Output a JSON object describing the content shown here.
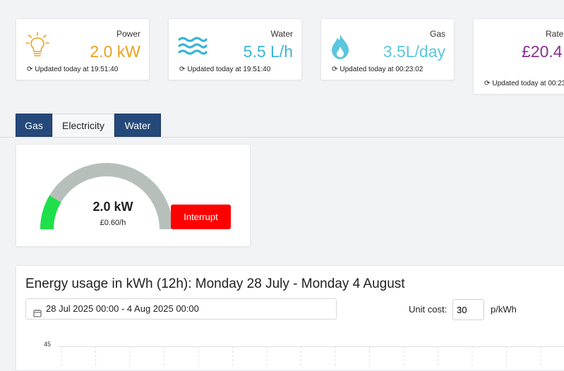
{
  "stats": {
    "power": {
      "label": "Power",
      "value": "2.0 kW",
      "updated": "Updated today at 19:51:40",
      "color": "#e8a21f",
      "icon": "lightbulb-icon"
    },
    "water": {
      "label": "Water",
      "value": "5.5 L/h",
      "updated": "Updated today at 19:51:40",
      "color": "#3cb4d6",
      "icon": "water-waves-icon"
    },
    "gas": {
      "label": "Gas",
      "value": "3.5L/day",
      "updated": "Updated today at 00:23:02",
      "color": "#5bc6dc",
      "icon": "flame-icon"
    },
    "rate": {
      "label": "Rate",
      "value": "£20.4",
      "updated": "Updated today at 00:23",
      "color": "#8b2d91"
    }
  },
  "tabs": [
    {
      "label": "Gas",
      "active": false
    },
    {
      "label": "Electricity",
      "active": true
    },
    {
      "label": "Water",
      "active": false
    }
  ],
  "gauge": {
    "value": "2.0 kW",
    "cost": "£0.60/h",
    "fraction": 0.17,
    "fill_color": "#1fe04a",
    "track_color": "#b7bfbb",
    "interrupt_label": "Interrupt"
  },
  "usage": {
    "title": "Energy usage in kWh (12h): Monday 28 July - Monday 4 August",
    "date_range": "28 Jul 2025 00:00 - 4 Aug 2025 00:00",
    "unit_cost_label": "Unit cost:",
    "unit_cost_value": "30",
    "unit_suffix": "p/kWh",
    "y_tick_top": "45"
  }
}
